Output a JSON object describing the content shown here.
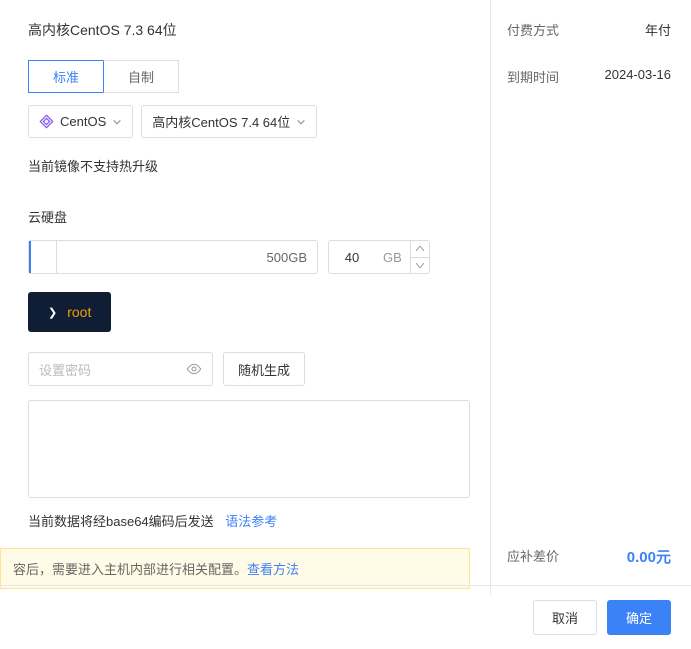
{
  "title": "高内核CentOS 7.3 64位",
  "tabs": {
    "standard": "标准",
    "custom": "自制"
  },
  "os_select": {
    "name": "CentOS"
  },
  "image_select": {
    "name": "高内核CentOS 7.4 64位"
  },
  "hot_upgrade_warning": "当前镜像不支持热升级",
  "disk": {
    "section_label": "云硬盘",
    "max_label": "500GB",
    "value": "40",
    "unit": "GB"
  },
  "root_button": "root",
  "password": {
    "placeholder": "设置密码",
    "random_btn": "随机生成"
  },
  "encode_note": "当前数据将经base64编码后发送",
  "encode_link": "语法参考",
  "notice": {
    "text": "容后，需要进入主机内部进行相关配置。",
    "link": "查看方法"
  },
  "right": {
    "payment_label": "付费方式",
    "payment_value": "年付",
    "expire_label": "到期时间",
    "expire_value": "2024-03-16",
    "diff_label": "应补差价",
    "diff_value": "0.00元"
  },
  "footer": {
    "cancel": "取消",
    "ok": "确定"
  }
}
